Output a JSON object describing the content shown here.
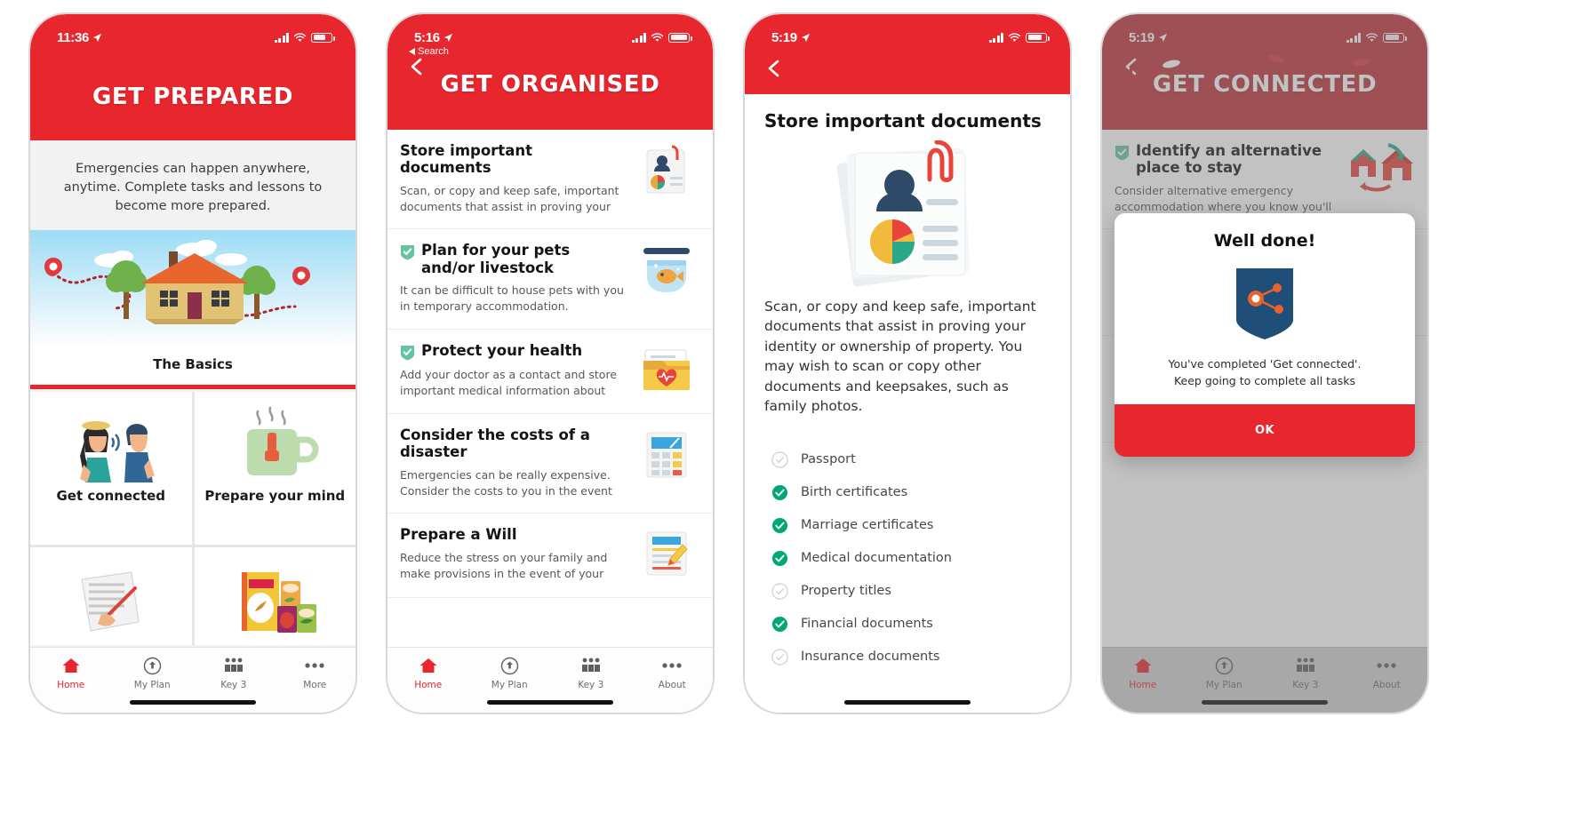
{
  "accent": {
    "red": "#e8262d",
    "red_dim": "#bd3137",
    "green": "#00a877",
    "green_soft": "#63c5a0",
    "navy": "#1f4e79",
    "gray_text": "#6e6e6e"
  },
  "tabs": [
    {
      "label": "Home",
      "icon": "home-icon"
    },
    {
      "label": "My Plan",
      "icon": "my-plan-icon"
    },
    {
      "label": "Key 3",
      "icon": "key3-icon"
    },
    {
      "label": "More",
      "icon": "more-icon"
    },
    {
      "label": "About",
      "icon": "about-icon"
    }
  ],
  "phone1": {
    "status": {
      "time": "11:36",
      "location_icon": "location-arrow-icon",
      "signal": "cellular-signal-icon",
      "wifi": "wifi-icon",
      "battery": "battery-icon"
    },
    "header_title": "GET PREPARED",
    "intro": "Emergencies can happen anywhere, anytime. Complete tasks and lessons to become more prepared.",
    "hero": {
      "caption": "The Basics",
      "art": "house-with-route-illustration"
    },
    "tiles": [
      {
        "label": "Get connected",
        "art": "two-people-talking-illustration"
      },
      {
        "label": "Prepare your mind",
        "art": "green-mug-illustration"
      },
      {
        "label": "",
        "art": "signing-document-illustration"
      },
      {
        "label": "",
        "art": "food-supplies-illustration"
      }
    ],
    "tabs": [
      "Home",
      "My Plan",
      "Key 3",
      "More"
    ],
    "active_tab": "Home"
  },
  "phone2": {
    "status": {
      "time": "5:16",
      "back_label": "Search"
    },
    "header_title": "GET ORGANISED",
    "tasks": [
      {
        "title": "Store important documents",
        "desc": "Scan, or copy and keep safe, important documents that assist in proving your",
        "done": false,
        "art": "documents-chart-icon"
      },
      {
        "title": "Plan for your pets and/or livestock",
        "desc": "It can be difficult to house pets with you in temporary accommodation.",
        "done": true,
        "art": "fishbowl-icon"
      },
      {
        "title": "Protect your health",
        "desc": "Add your doctor as a contact and store important medical information about",
        "done": true,
        "art": "medical-folder-icon"
      },
      {
        "title": "Consider the costs of a disaster",
        "desc": "Emergencies can be really expensive. Consider the costs to you in the event",
        "done": false,
        "art": "calculator-icon"
      },
      {
        "title": "Prepare a Will",
        "desc": "Reduce the stress on your family and make provisions in the event of your",
        "done": false,
        "art": "document-pencil-icon"
      }
    ],
    "tabs": [
      "Home",
      "My Plan",
      "Key 3",
      "About"
    ],
    "active_tab": "Home"
  },
  "phone3": {
    "status": {
      "time": "5:19"
    },
    "title": "Store important documents",
    "art": "documents-chart-illustration",
    "body": "Scan, or copy and keep safe, important documents that assist in proving your identity or ownership of property. You may wish to scan or copy other documents and keepsakes, such as family photos.",
    "checklist": [
      {
        "label": "Passport",
        "done": false
      },
      {
        "label": "Birth certificates",
        "done": true
      },
      {
        "label": "Marriage certificates",
        "done": true
      },
      {
        "label": "Medical documentation",
        "done": true
      },
      {
        "label": "Property titles",
        "done": false
      },
      {
        "label": "Financial documents",
        "done": true
      },
      {
        "label": "Insurance documents",
        "done": false
      }
    ]
  },
  "phone4": {
    "status": {
      "time": "5:19"
    },
    "header_title": "GET CONNECTED",
    "task": {
      "title": "Identify an alternative place to stay",
      "desc": "Consider alternative emergency accommodation where you know you'll",
      "done": true,
      "art": "house-relocation-icon"
    },
    "modal": {
      "title": "Well done!",
      "logo": "shield-network-logo",
      "text_line1": "You've completed 'Get connected'.",
      "text_line2": "Keep going to complete all tasks",
      "ok_label": "OK"
    },
    "tabs": [
      "Home",
      "My Plan",
      "Key 3",
      "About"
    ],
    "active_tab": "Home"
  }
}
